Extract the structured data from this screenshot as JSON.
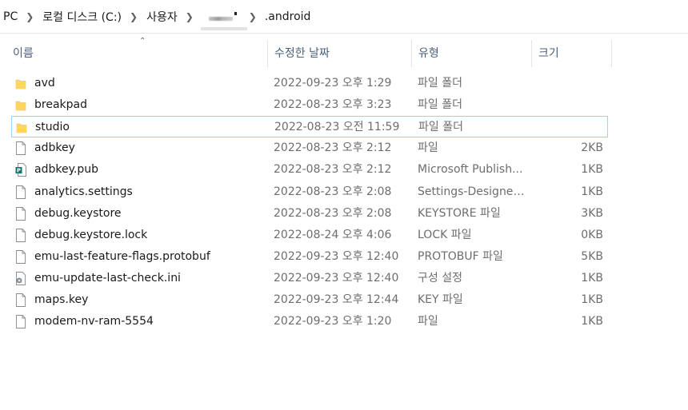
{
  "address": {
    "crumbs": [
      "PC",
      "로컬 디스크 (C:)",
      "사용자"
    ],
    "current": ".android"
  },
  "columns": {
    "name": "이름",
    "date": "수정한 날짜",
    "type": "유형",
    "size": "크기"
  },
  "files": [
    {
      "name": "avd",
      "date": "2022-09-23 오후 1:29",
      "type": "파일 폴더",
      "size": "",
      "icon": "folder-icon"
    },
    {
      "name": "breakpad",
      "date": "2022-08-23 오후 3:23",
      "type": "파일 폴더",
      "size": "",
      "icon": "folder-icon"
    },
    {
      "name": "studio",
      "date": "2022-08-23 오전 11:59",
      "type": "파일 폴더",
      "size": "",
      "icon": "folder-icon"
    },
    {
      "name": "adbkey",
      "date": "2022-08-23 오후 2:12",
      "type": "파일",
      "size": "2KB",
      "icon": "file-icon"
    },
    {
      "name": "adbkey.pub",
      "date": "2022-08-23 오후 2:12",
      "type": "Microsoft Publish...",
      "size": "1KB",
      "icon": "publisher-file-icon"
    },
    {
      "name": "analytics.settings",
      "date": "2022-08-23 오후 2:08",
      "type": "Settings-Designer...",
      "size": "1KB",
      "icon": "file-icon"
    },
    {
      "name": "debug.keystore",
      "date": "2022-08-23 오후 2:08",
      "type": "KEYSTORE 파일",
      "size": "3KB",
      "icon": "file-icon"
    },
    {
      "name": "debug.keystore.lock",
      "date": "2022-08-24 오후 4:06",
      "type": "LOCK 파일",
      "size": "0KB",
      "icon": "file-icon"
    },
    {
      "name": "emu-last-feature-flags.protobuf",
      "date": "2022-09-23 오후 12:40",
      "type": "PROTOBUF 파일",
      "size": "5KB",
      "icon": "file-icon"
    },
    {
      "name": "emu-update-last-check.ini",
      "date": "2022-09-23 오후 12:40",
      "type": "구성 설정",
      "size": "1KB",
      "icon": "config-file-icon"
    },
    {
      "name": "maps.key",
      "date": "2022-09-23 오후 12:44",
      "type": "KEY 파일",
      "size": "1KB",
      "icon": "file-icon"
    },
    {
      "name": "modem-nv-ram-5554",
      "date": "2022-09-23 오후 1:20",
      "type": "파일",
      "size": "1KB",
      "icon": "file-icon"
    }
  ],
  "selected_file": "studio",
  "colors": {
    "header_text": "#4c607a",
    "selection_border": "#99d1ff",
    "folder": "#f8d775",
    "secondary_text": "#6d6d6d"
  }
}
